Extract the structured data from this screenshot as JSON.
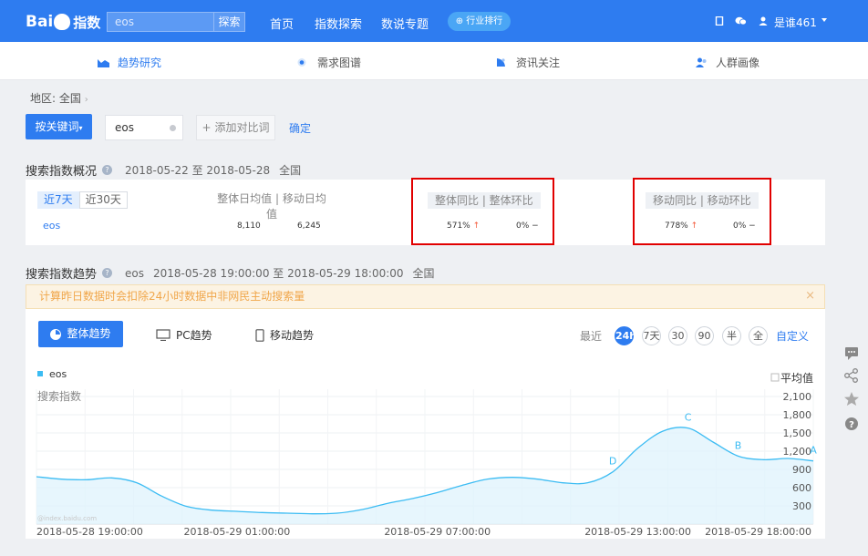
{
  "topbar": {
    "logo": {
      "left": "Bai",
      "right": "指数"
    },
    "search": {
      "value": "eos",
      "button": "探索"
    },
    "nav": [
      "首页",
      "指数探索",
      "数说专题"
    ],
    "rank_pill": "行业排行",
    "user": "是谁461"
  },
  "subnav": [
    "趋势研究",
    "需求图谱",
    "资讯关注",
    "人群画像"
  ],
  "breadcrumb": "地区:  全国",
  "keyword_bar": {
    "mode_button": "按关键词",
    "keyword": "eos",
    "add_compare": "添加对比词",
    "confirm": "确定"
  },
  "overview": {
    "title": "搜索指数概况",
    "date_range": "2018-05-22 至 2018-05-28",
    "region": "全国",
    "tabs": [
      "近7天",
      "近30天"
    ],
    "headers": {
      "daily": "整体日均值  |  移动日均值",
      "yoy": "整体同比  |  整体环比",
      "mobile": "移动同比  |  移动环比"
    },
    "row": {
      "keyword": "eos",
      "total_daily": "8,110",
      "mobile_daily": "6,245",
      "total_yoy": "571%",
      "total_mom": "0%",
      "mobile_yoy": "778%",
      "mobile_mom": "0%"
    }
  },
  "trend": {
    "title": "搜索指数趋势",
    "keyword": "eos",
    "range": "2018-05-28 19:00:00 至 2018-05-29 18:00:00",
    "region": "全国",
    "notice": "计算昨日数据时会扣除24小时数据中非网民主动搜索量",
    "tabs": [
      "整体趋势",
      "PC趋势",
      "移动趋势"
    ],
    "range_label": "最近",
    "ranges": [
      "24h",
      "7天",
      "30",
      "90",
      "半",
      "全"
    ],
    "custom": "自定义",
    "avg_toggle": "平均值",
    "watermark": "@index.baidu.com"
  },
  "chart_data": {
    "type": "area",
    "ylabel": "搜索指数",
    "legend": [
      "eos"
    ],
    "ylim": [
      0,
      2200
    ],
    "yticks": [
      "2,100",
      "1,800",
      "1,500",
      "1,200",
      "900",
      "600",
      "300"
    ],
    "xticks": [
      "2018-05-28 19:00:00",
      "2018-05-29 01:00:00",
      "2018-05-29 07:00:00",
      "2018-05-29 13:00:00",
      "2018-05-29 18:00:00"
    ],
    "series": [
      {
        "name": "eos",
        "color": "#3cbcf3",
        "values": [
          780,
          740,
          730,
          760,
          680,
          460,
          290,
          230,
          210,
          190,
          180,
          170,
          180,
          240,
          340,
          420,
          520,
          640,
          740,
          770,
          740,
          680,
          680,
          860,
          1250,
          1530,
          1580,
          1350,
          1120,
          1060,
          1080,
          1040
        ]
      }
    ],
    "annotations": [
      {
        "label": "D",
        "index": 23
      },
      {
        "label": "C",
        "index": 26
      },
      {
        "label": "B",
        "index": 28
      },
      {
        "label": "A",
        "index": 31
      }
    ]
  }
}
